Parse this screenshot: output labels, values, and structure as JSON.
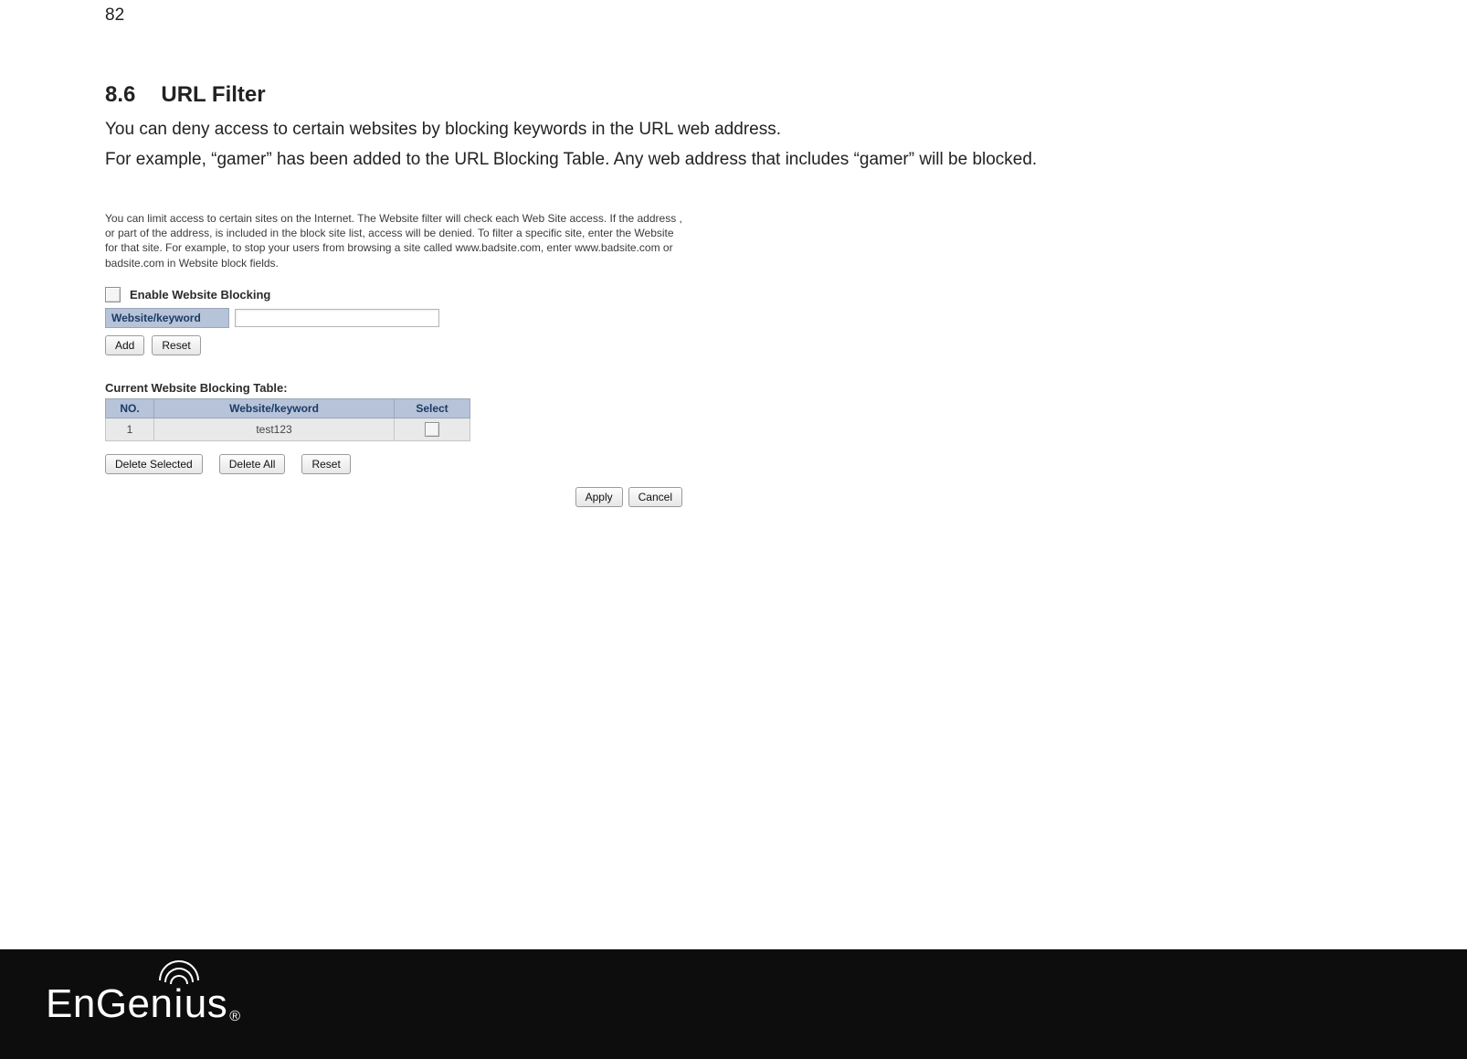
{
  "page_number": "82",
  "section": {
    "number": "8.6",
    "title": "URL Filter",
    "paragraph1": "You can deny access to certain websites by blocking keywords in the URL web address.",
    "paragraph2": "For example, “gamer” has been added to the URL Blocking Table. Any web address that includes “gamer” will be blocked."
  },
  "panel": {
    "intro": "You can limit access to certain sites on the Internet. The Website filter will check each Web Site access. If the address , or part of the address, is included in the block site list, access will be denied. To filter a specific site, enter the Website for that site. For example, to stop your users from browsing a site called www.badsite.com, enter www.badsite.com or badsite.com in Website block fields.",
    "enable_label": "Enable Website Blocking",
    "enable_checked": false,
    "keyword_label": "Website/keyword",
    "keyword_value": "",
    "add_label": "Add",
    "reset_label": "Reset",
    "table_title": "Current Website Blocking Table:",
    "columns": {
      "no": "NO.",
      "kw": "Website/keyword",
      "select": "Select"
    },
    "rows": [
      {
        "no": "1",
        "kw": "test123",
        "selected": false
      }
    ],
    "delete_selected_label": "Delete Selected",
    "delete_all_label": "Delete All",
    "reset2_label": "Reset",
    "apply_label": "Apply",
    "cancel_label": "Cancel"
  },
  "footer": {
    "brand": "EnGenius",
    "registered": "®"
  }
}
